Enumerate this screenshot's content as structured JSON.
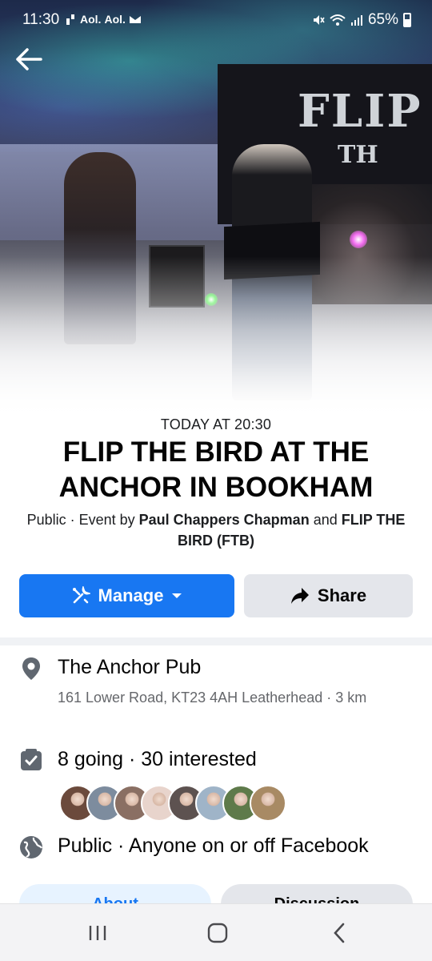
{
  "status_bar": {
    "time": "11:30",
    "notification_labels": [
      "Aol.",
      "Aol."
    ],
    "battery": "65%"
  },
  "hero": {
    "banner_word1": "FLIP",
    "banner_word2": "TH"
  },
  "event": {
    "when": "TODAY AT 20:30",
    "title": "FLIP THE BIRD AT THE ANCHOR IN BOOKHAM",
    "privacy_prefix": "Public · Event by ",
    "host1": "Paul Chappers Chapman",
    "and": " and ",
    "host2": "FLIP THE BIRD (FTB)"
  },
  "actions": {
    "manage_label": "Manage",
    "share_label": "Share"
  },
  "details": {
    "place_name": "The Anchor Pub",
    "place_address": "161 Lower Road, KT23 4AH Leatherhead · 3 km",
    "going_text": "8 going · 30 interested",
    "privacy_text": "Public · Anyone on or off Facebook"
  },
  "avatars": [
    "#6b4a3c",
    "#7d8c9e",
    "#8a6f63",
    "#e8d4cc",
    "#5d5250",
    "#9fb4c8",
    "#5e7a4a",
    "#a88a64"
  ],
  "tabs": {
    "about": "About",
    "discussion": "Discussion"
  },
  "colors": {
    "accent": "#1877f2",
    "secondary_button": "#e4e6eb"
  }
}
